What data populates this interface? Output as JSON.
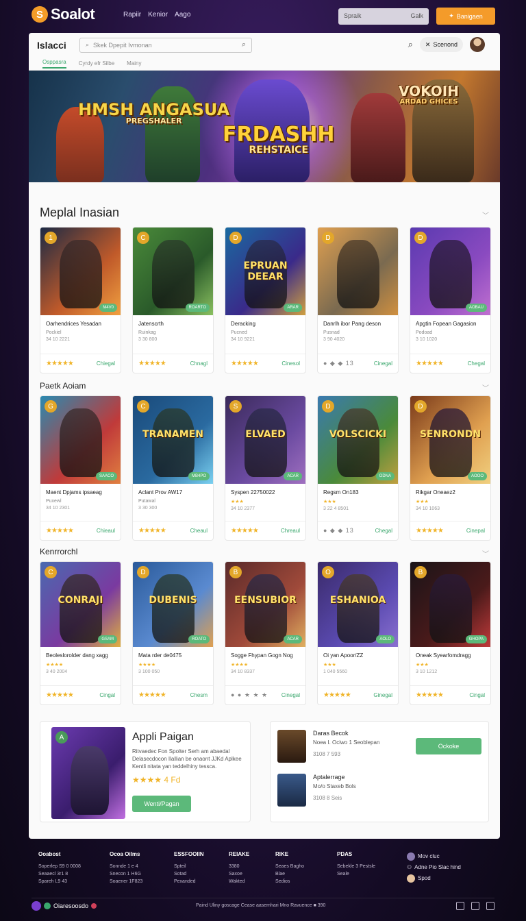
{
  "topbar": {
    "logo_text": "Soalot",
    "nav": [
      "Rapiir",
      "Kenior",
      "Aago"
    ],
    "search_placeholder": "Spraik",
    "search_button": "Galk",
    "cta_label": "Banigaen"
  },
  "panel": {
    "brand": "Islacci",
    "search_placeholder": "Skek Dpepit Ivmonan",
    "account_label": "Scenond",
    "tabs": [
      "Osppasra",
      "Cyrdy efr Silbe",
      "Mainy"
    ]
  },
  "banner": {
    "left_title": "HMSH ANGASUA",
    "left_sub": "PREGSHALER",
    "center_title": "FRDASHH",
    "center_sub": "REHSTAICE",
    "right_title": "VOKOIH",
    "right_sub": "ARDAD GHICES"
  },
  "sections": [
    {
      "title": "Meplal Inasian",
      "cards": [
        {
          "rank": "1",
          "name": "Oarhendrices Yesadan",
          "sub": "Pockiel",
          "meta": "34 10 2221",
          "get": "Chiegal",
          "tag": "M4V0"
        },
        {
          "rank": "C",
          "name": "Jatenscrth",
          "sub": "Ruinkag",
          "meta": "3 30 800",
          "get": "Chnagl",
          "tag": "ROARTO"
        },
        {
          "rank": "D",
          "name": "Deracking",
          "sub": "Pucned",
          "meta": "34 10 9221",
          "get": "Cinesol",
          "tag": "ARAR",
          "art": "EPRUAN DEEAR"
        },
        {
          "rank": "D",
          "name": "Danrlh ibor Pang deson",
          "sub": "Pusnad",
          "meta": "3 90 4020",
          "get": "Cinegal",
          "tag": "",
          "foot_stars": "● ◆ ◆ 13"
        },
        {
          "rank": "D",
          "name": "Apgtin Fopean Gagasion",
          "sub": "Podoad",
          "meta": "3 10 1020",
          "get": "Chegal",
          "tag": "AOBAU"
        }
      ]
    },
    {
      "title": "Paetk Aoiam",
      "cards": [
        {
          "rank": "G",
          "name": "Maent Dpjams ipsaeag",
          "sub": "Puxewl",
          "meta": "34 10 2301",
          "get": "Chieaul",
          "tag": "SAACO"
        },
        {
          "rank": "C",
          "name": "Aclant Prov AW17",
          "sub": "Putawal",
          "meta": "3 30 300",
          "get": "Cheaul",
          "tag": "MB4PO",
          "art": "TRANAMEN"
        },
        {
          "rank": "S",
          "name": "Syspen 22750022",
          "sub": "★★★",
          "meta": "34 10 2377",
          "get": "Chreaul",
          "tag": "ACAR",
          "art": "ELVAED"
        },
        {
          "rank": "D",
          "name": "Regsm On183",
          "sub": "★★★",
          "meta": "3 22 4 8501",
          "get": "Chegal",
          "tag": "ODNA",
          "art": "VOLSCICKI",
          "foot_stars": "● ◆ ◆ 13"
        },
        {
          "rank": "D",
          "name": "Rikgar Oneaez2",
          "sub": "★★★",
          "meta": "34 10 1063",
          "get": "Cinepal",
          "tag": "AOOO",
          "art": "SENRONDN"
        }
      ]
    },
    {
      "title": "Kenrrorchl",
      "cards": [
        {
          "rank": "C",
          "name": "Beoleslorolder dang xagg",
          "sub": "★★★★",
          "meta": "3 40 2004",
          "get": "Cingal",
          "tag": "GSAM",
          "art": "CONRAJI"
        },
        {
          "rank": "D",
          "name": "Mata rder de0475",
          "sub": "★★★★",
          "meta": "3 100 050",
          "get": "Chesm",
          "tag": "ROATO",
          "art": "DUBENIS"
        },
        {
          "rank": "B",
          "name": "Sogge Fhypan Gogn Nog",
          "sub": "★★★★",
          "meta": "34 10 8337",
          "get": "Cinegal",
          "tag": "ACAR",
          "art": "EENSUBIOR",
          "foot_stars": "● ● ★ ★ ★"
        },
        {
          "rank": "O",
          "name": "Oi yan Apoor/ZZ",
          "sub": "★★★",
          "meta": "1 040 5560",
          "get": "Ginegal",
          "tag": "AOLO",
          "art": "ESHANIOA"
        },
        {
          "rank": "B",
          "name": "Oneak Syearfomdragg",
          "sub": "★★★",
          "meta": "3 10 1212",
          "get": "Cingal",
          "tag": "GHOPA"
        }
      ]
    }
  ],
  "promo": {
    "title": "Appli Paigan",
    "desc": "Ritvaedec Fon Spolter Serh am abaedal Delasecdocon Ilallian be onaont JJKd Aplkee Kentli nitata yan teddelhiny tessca.",
    "stars": "★★★★ 4 Fd",
    "button": "Wenti/Pagan"
  },
  "side": {
    "row1_title": "Daras Becok",
    "row1_sub": "Noea I. Ociwo 1 Seoblepan",
    "row1_meta": "3108 7 593",
    "button": "Ockoke",
    "row2_title": "Aptalerrage",
    "row2_sub": "Mo/o Staxeb Bols",
    "row2_meta": "3108 8 Seis"
  },
  "footer": {
    "cols": [
      {
        "head": "Ooabost",
        "links": [
          "Soperlep S9 0 0008",
          "Seaaecl 3r1 8",
          "Spareh L9 43"
        ]
      },
      {
        "head": "Ocoa Oilms",
        "links": [
          "Sonnde 1 e 4",
          "Snecon 1 H6G",
          "Soaener 1F823"
        ]
      },
      {
        "head": "ESSFOOIIN",
        "links": [
          "Spteil",
          "Sotad",
          "Pexanded"
        ]
      },
      {
        "head": "REIAKE",
        "links": [
          "3380",
          "Saxoe",
          "Wakted"
        ]
      },
      {
        "head": "RIKE",
        "links": [
          "Seaes Bagho",
          "Blae",
          "Sedios"
        ]
      },
      {
        "head": "PDAS",
        "links": [
          "Sebekle 3 Pestsle",
          "Seale"
        ]
      }
    ],
    "social": [
      "Mov cluc",
      "Adne Pio Slac hind",
      "Spod"
    ],
    "bottom_brand": "Oiaresoosdo",
    "copyright": "Paind Uliny goscage Cease aasemhari Mno Ravuence ■ 390"
  },
  "colors": {
    "accent": "#f49b2a",
    "green": "#5cb97a",
    "star": "#f0b429"
  }
}
